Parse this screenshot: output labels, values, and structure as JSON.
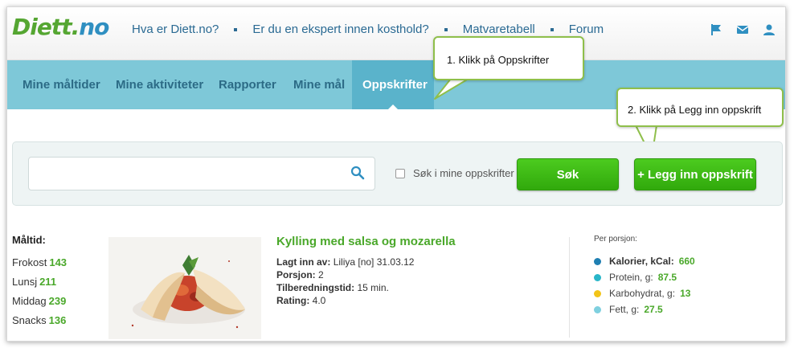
{
  "brand": {
    "logo_main": "Diett",
    "logo_dot": ".",
    "logo_tld": "no"
  },
  "top_links": [
    "Hva er Diett.no?",
    "Er du en ekspert innen kosthold?",
    "Matvaretabell",
    "Forum"
  ],
  "top_icons": [
    "flag-icon",
    "mail-icon",
    "user-icon"
  ],
  "nav": {
    "items": [
      "Mine måltider",
      "Mine aktiviteter",
      "Rapporter",
      "Mine mål",
      "Oppskrifter"
    ],
    "active": "Oppskrifter"
  },
  "callouts": {
    "step1": "1. Klikk på Oppskrifter",
    "step2": "2. Klikk på Legg inn oppskrift"
  },
  "search": {
    "input_value": "",
    "checkbox_label": "Søk i mine oppskrifter",
    "checkbox_checked": false,
    "search_button": "Søk",
    "add_button": "+ Legg inn oppskrift"
  },
  "meals": {
    "header": "Måltid:",
    "items": [
      {
        "label": "Frokost",
        "value": "143"
      },
      {
        "label": "Lunsj",
        "value": "211"
      },
      {
        "label": "Middag",
        "value": "239"
      },
      {
        "label": "Snacks",
        "value": "136"
      }
    ]
  },
  "recipe": {
    "title": "Kylling med salsa og mozarella",
    "added_by_label": "Lagt inn av:",
    "added_by_value": "Liliya [no] 31.03.12",
    "portions_label": "Porsjon:",
    "portions_value": "2",
    "prep_label": "Tilberedningstid:",
    "prep_value": "15 min.",
    "rating_label": "Rating:",
    "rating_value": "4.0"
  },
  "nutrition": {
    "header": "Per porsjon:",
    "items": [
      {
        "label": "Kalorier, kCal:",
        "value": "660",
        "color": "#1f7fb2"
      },
      {
        "label": "Protein, g:",
        "value": "87.5",
        "color": "#29b6c9"
      },
      {
        "label": "Karbohydrat, g:",
        "value": "13",
        "color": "#f2c418"
      },
      {
        "label": "Fett, g:",
        "value": "27.5",
        "color": "#7fd0df"
      }
    ]
  },
  "colors": {
    "accent_green": "#4aa82a",
    "nav_bg": "#7ec8d8",
    "nav_active": "#5ab3cb",
    "link_blue": "#2a6a93"
  }
}
